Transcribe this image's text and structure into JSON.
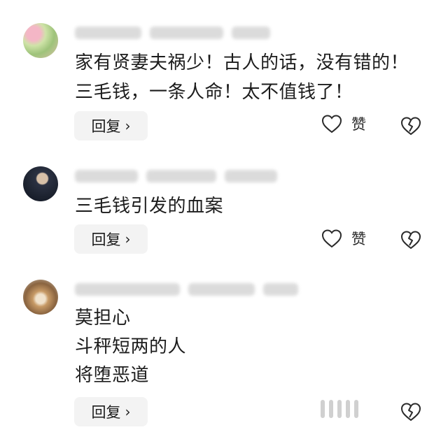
{
  "comments": [
    {
      "text_lines": [
        "家有贤妻夫祸少！古人的话，没有错的！",
        "三毛钱，一条人命！太不值钱了！"
      ],
      "reply_label": "回复",
      "like_label": "赞",
      "chevron": "›"
    },
    {
      "text_lines": [
        "三毛钱引发的血案"
      ],
      "reply_label": "回复",
      "like_label": "赞",
      "chevron": "›"
    },
    {
      "text_lines": [
        "莫担心",
        "斗秤短两的人",
        "将堕恶道"
      ],
      "reply_label": "回复",
      "chevron": "›"
    }
  ],
  "icons": {
    "like": "heart-outline-icon",
    "dislike": "broken-heart-icon",
    "reply_arrow": "chevron-right-icon"
  },
  "colors": {
    "reply_bg": "#f3f3f3",
    "text": "#1c1c1c"
  }
}
